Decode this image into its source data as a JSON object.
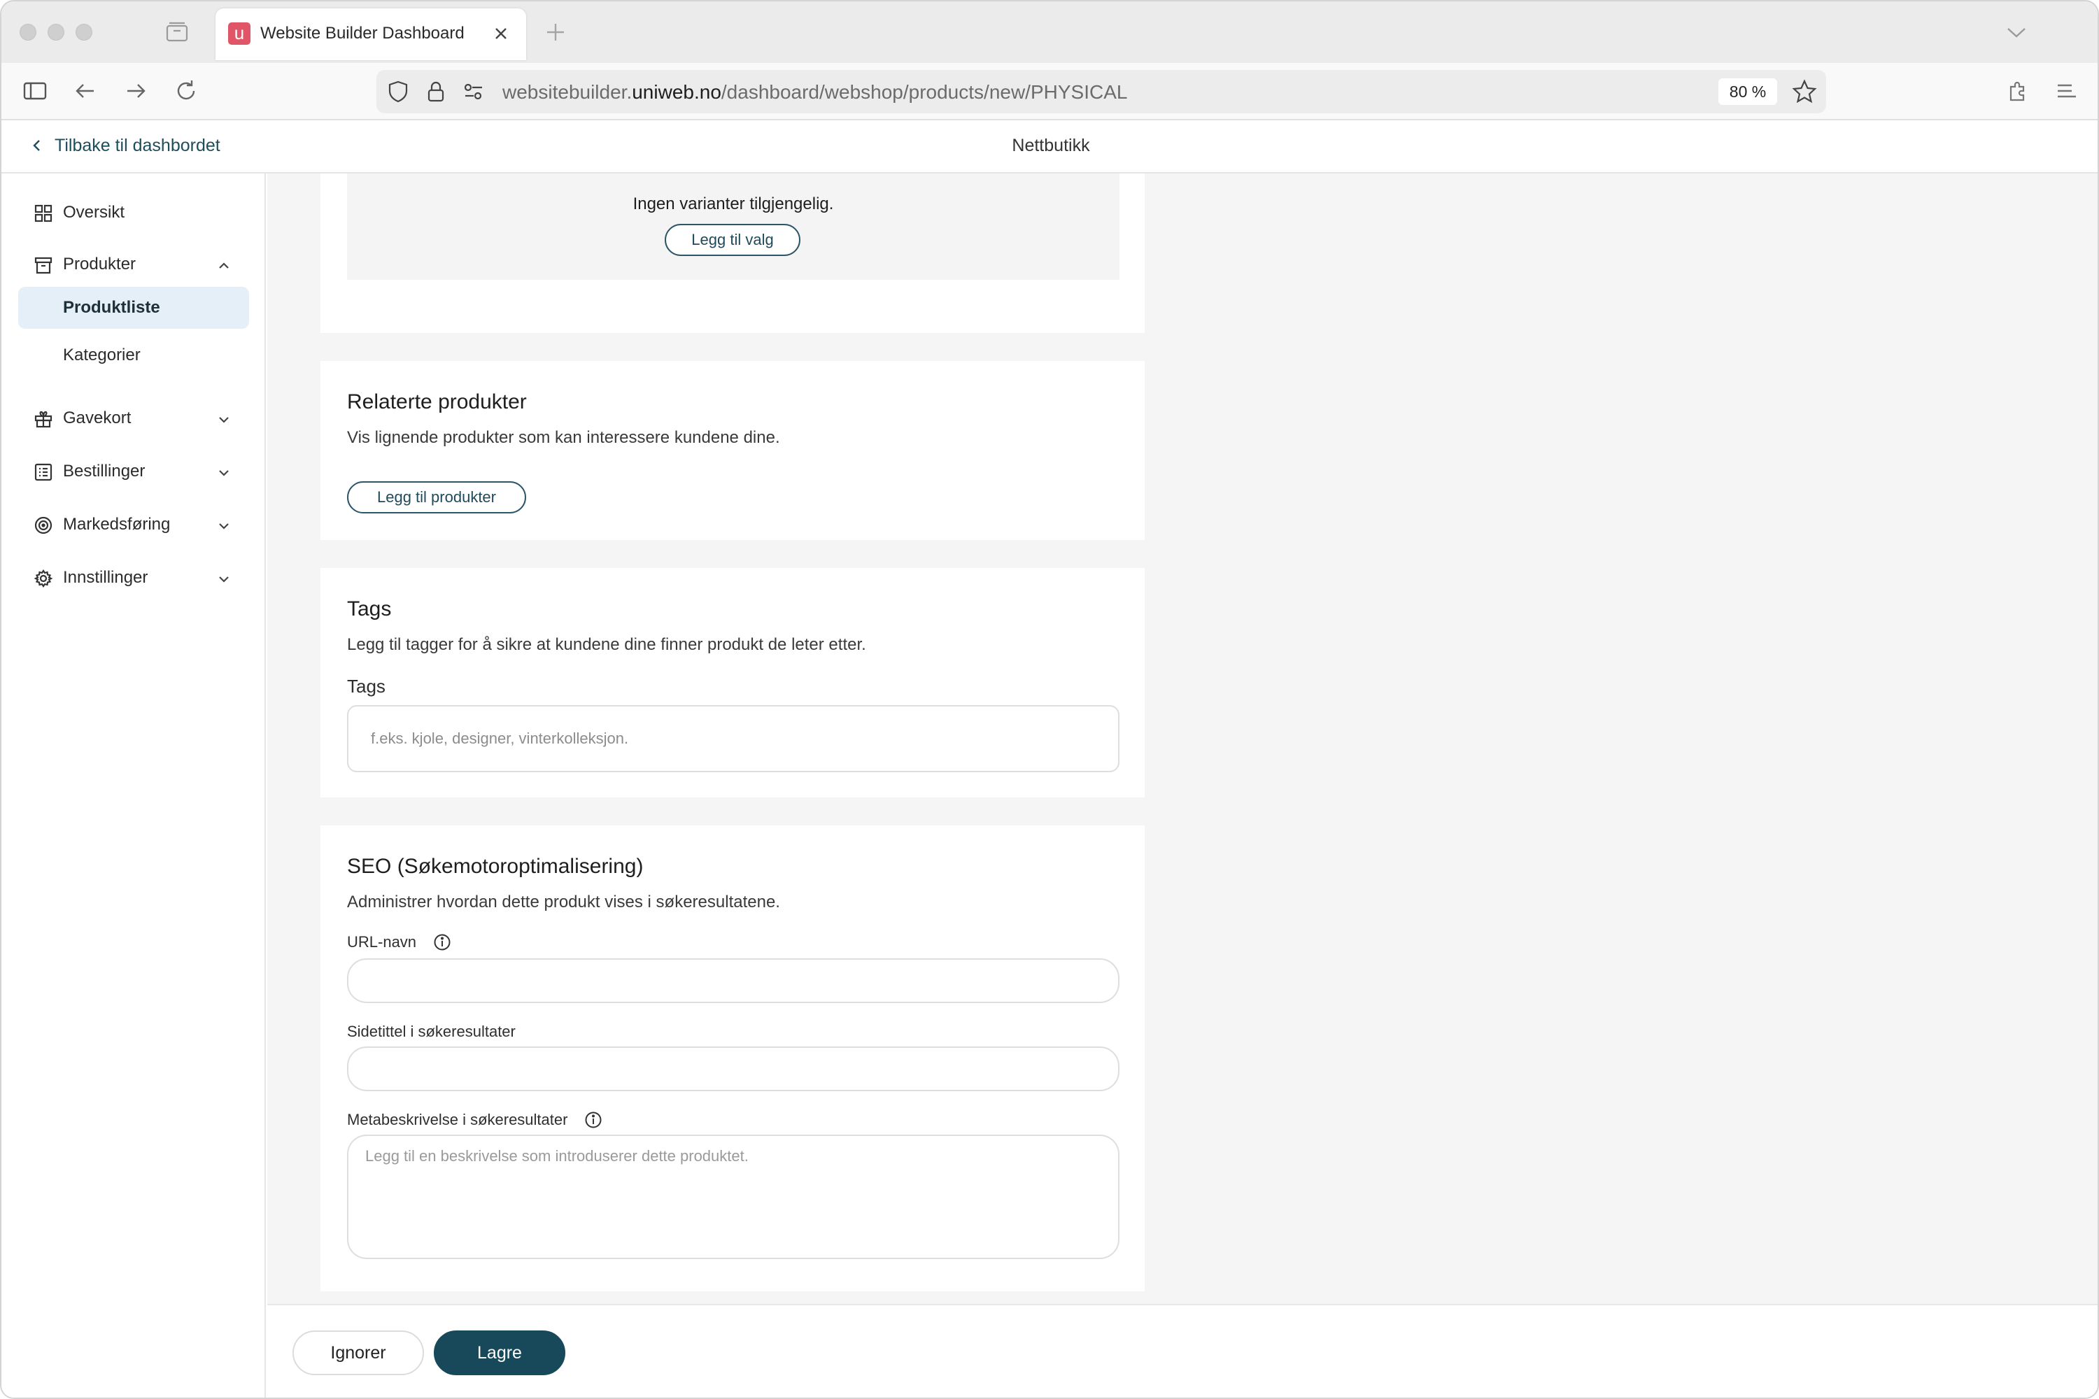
{
  "browser": {
    "tab_title": "Website Builder Dashboard",
    "tab_favicon_letter": "u",
    "url_prefix": "websitebuilder.",
    "url_domain": "uniweb.no",
    "url_path": "/dashboard/webshop/products/new/PHYSICAL",
    "zoom": "80 %"
  },
  "header": {
    "back_label": "Tilbake til dashbordet",
    "title": "Nettbutikk"
  },
  "sidebar": {
    "items": [
      {
        "label": "Oversikt",
        "icon": "grid-icon"
      },
      {
        "label": "Produkter",
        "icon": "archive-box-icon",
        "expanded": true
      },
      {
        "label": "Gavekort",
        "icon": "gift-icon"
      },
      {
        "label": "Bestillinger",
        "icon": "list-icon"
      },
      {
        "label": "Markedsføring",
        "icon": "target-icon"
      },
      {
        "label": "Innstillinger",
        "icon": "gear-icon"
      }
    ],
    "sub_items": [
      {
        "label": "Produktliste",
        "active": true
      },
      {
        "label": "Kategorier",
        "active": false
      }
    ]
  },
  "variants": {
    "empty_text": "Ingen varianter tilgjengelig.",
    "add_option_label": "Legg til valg"
  },
  "related": {
    "title": "Relaterte produkter",
    "description": "Vis lignende produkter som kan interessere kundene dine.",
    "add_label": "Legg til produkter"
  },
  "tags": {
    "title": "Tags",
    "description": "Legg til tagger for å sikre at kundene dine finner produkt de leter etter.",
    "field_label": "Tags",
    "placeholder": "f.eks. kjole, designer, vinterkolleksjon."
  },
  "seo": {
    "title": "SEO (Søkemotoroptimalisering)",
    "description": "Administrer hvordan dette produkt vises i søkeresultatene.",
    "url_label": "URL-navn",
    "url_value": "",
    "page_title_label": "Sidetittel i søkeresultater",
    "page_title_value": "",
    "meta_label": "Metabeskrivelse i søkeresultater",
    "meta_placeholder": "Legg til en beskrivelse som introduserer dette produktet."
  },
  "footer": {
    "ignore_label": "Ignorer",
    "save_label": "Lagre"
  },
  "colors": {
    "accent": "#17495b",
    "active_nav_bg": "#e5eff8",
    "favicon": "#e05567"
  }
}
